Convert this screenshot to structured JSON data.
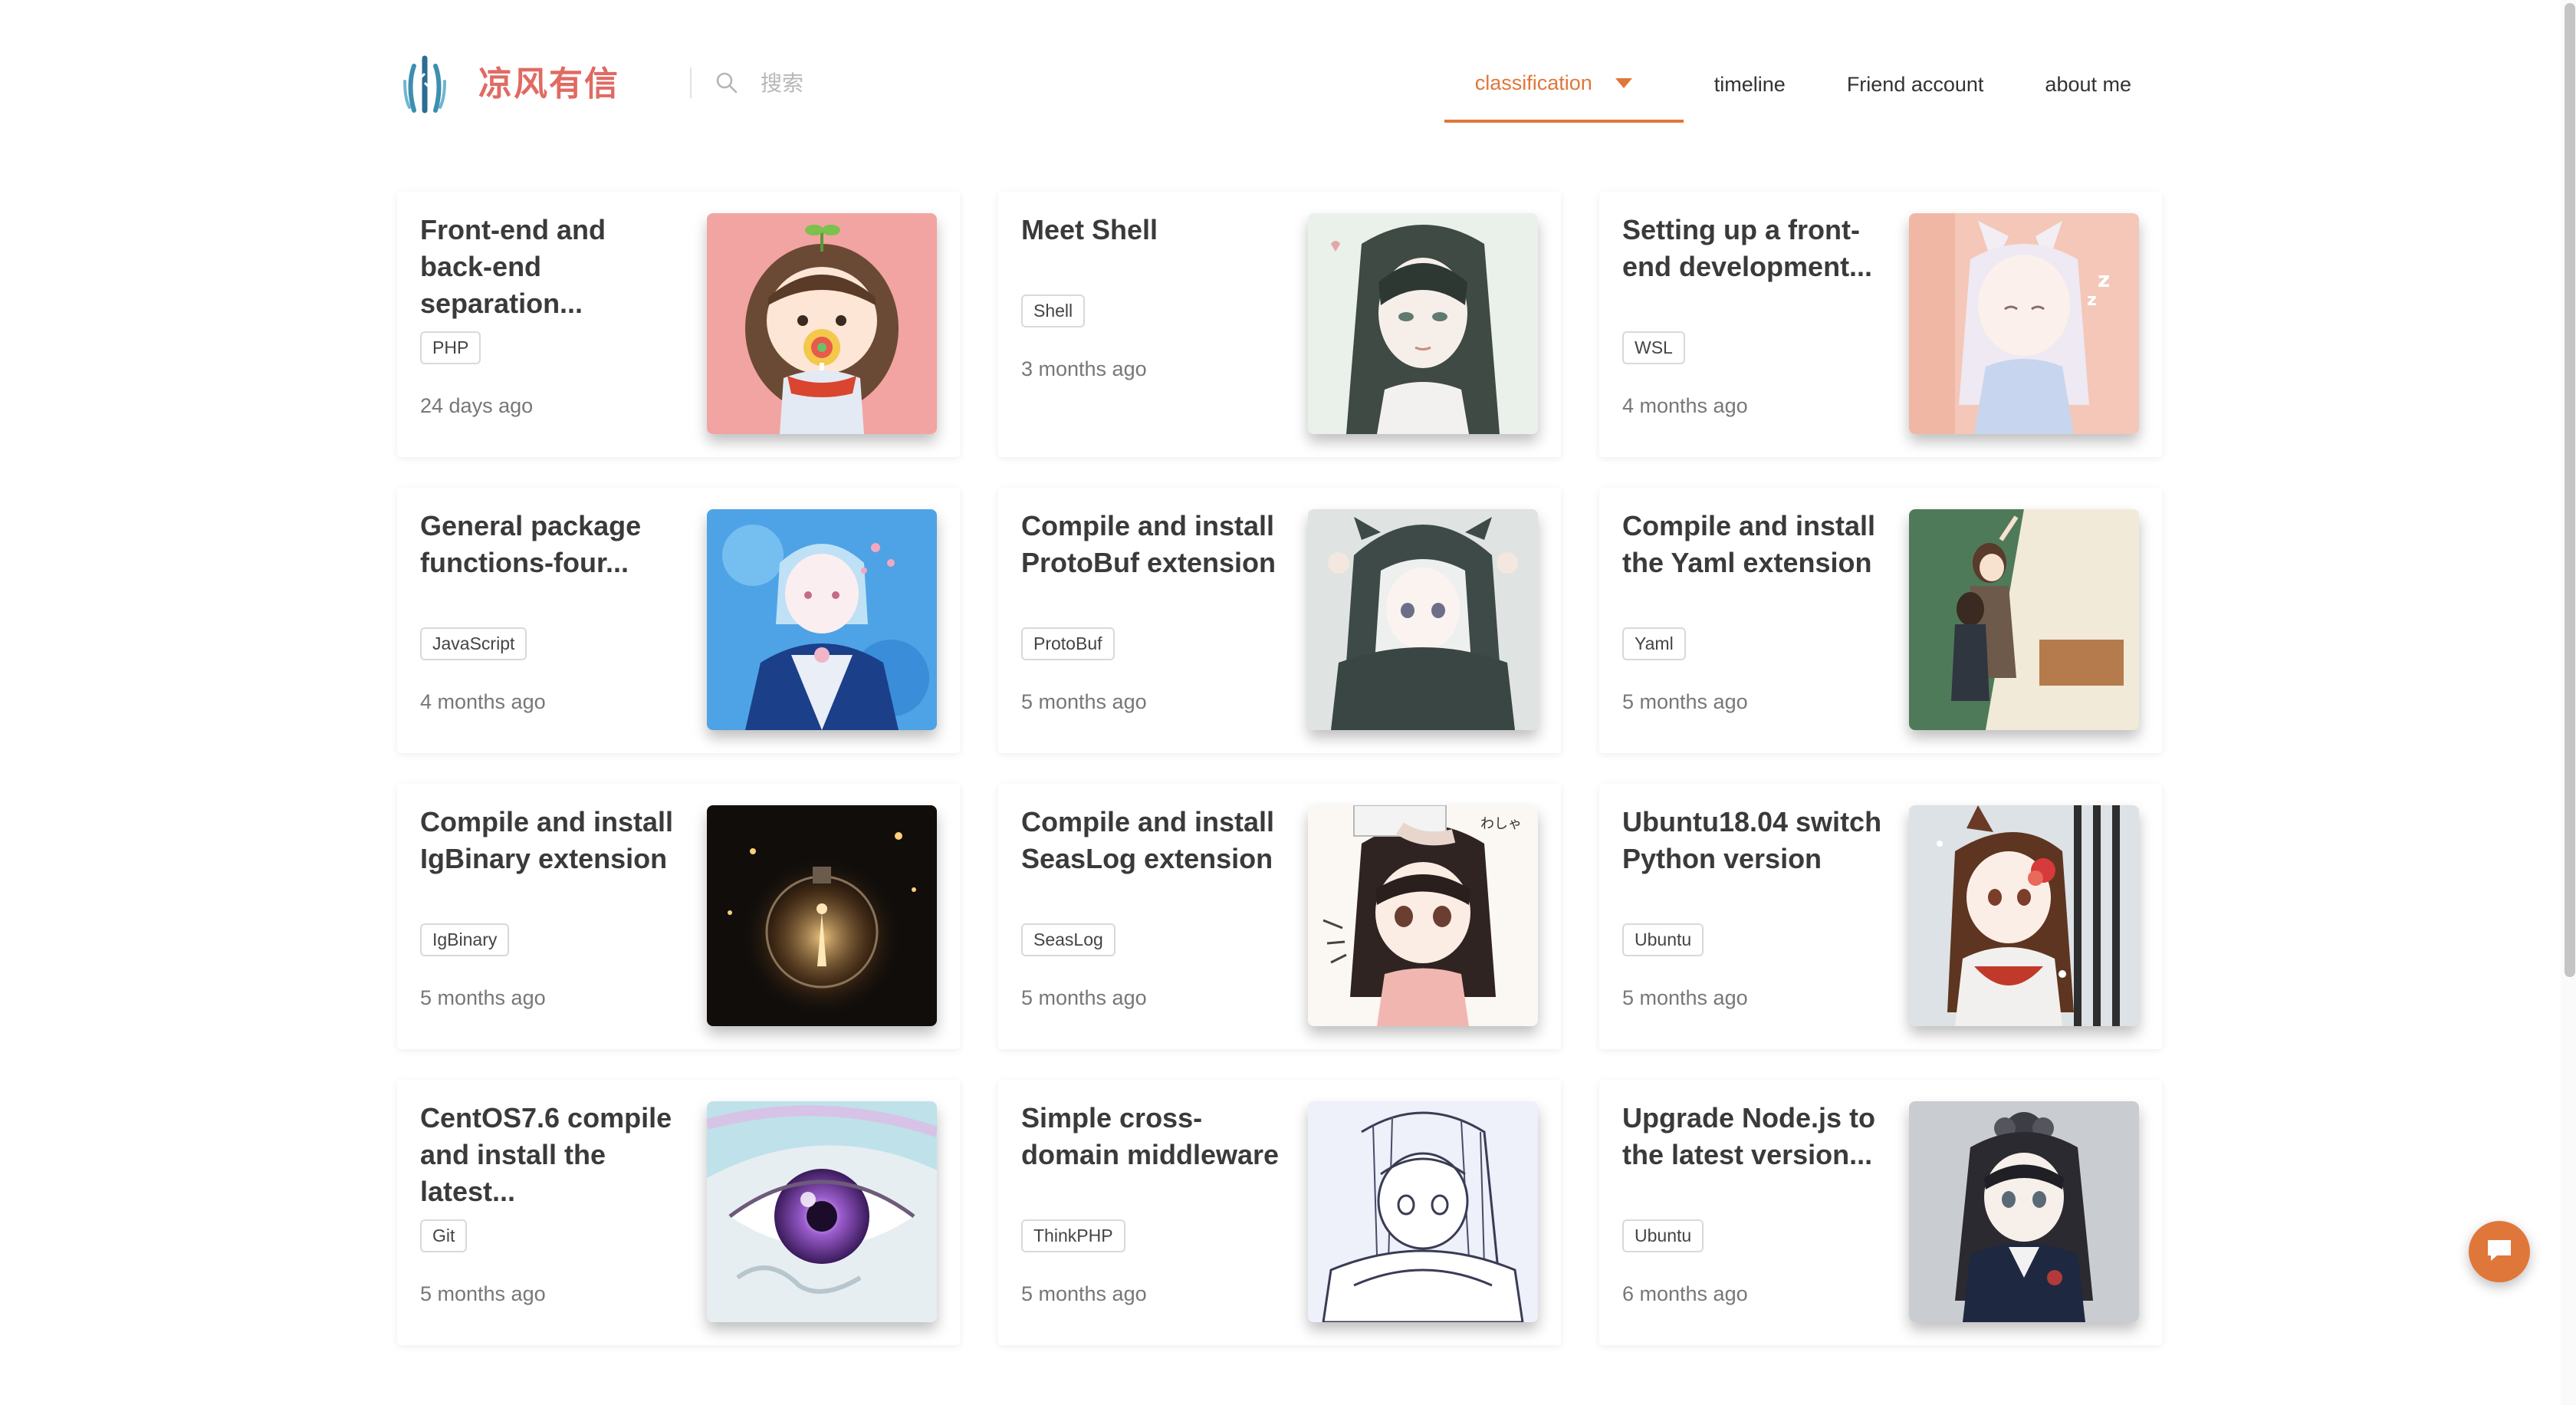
{
  "header": {
    "brand": "凉风有信",
    "search_placeholder": "搜索",
    "nav": [
      {
        "label": "classification",
        "active": true
      },
      {
        "label": "timeline"
      },
      {
        "label": "Friend account"
      },
      {
        "label": "about me"
      }
    ]
  },
  "posts": [
    {
      "title": "Front-end and back-end separation...",
      "tag": "PHP",
      "time": "24 days ago",
      "image": "girl-with-lollipop"
    },
    {
      "title": "Meet Shell",
      "tag": "Shell",
      "time": "3 months ago",
      "image": "long-haired-girl"
    },
    {
      "title": "Setting up a front-end development...",
      "tag": "WSL",
      "time": "4 months ago",
      "image": "cat-ear-girl-sleeping"
    },
    {
      "title": "General package functions-four...",
      "tag": "JavaScript",
      "time": "4 months ago",
      "image": "blue-underwater-boy"
    },
    {
      "title": "Compile and install ProtoBuf extension",
      "tag": "ProtoBuf",
      "time": "5 months ago",
      "image": "hooded-girl"
    },
    {
      "title": "Compile and install the Yaml extension",
      "tag": "Yaml",
      "time": "5 months ago",
      "image": "couple-at-blackboard"
    },
    {
      "title": "Compile and install IgBinary extension",
      "tag": "IgBinary",
      "time": "5 months ago",
      "image": "light-bulb-girl"
    },
    {
      "title": "Compile and install SeasLog extension",
      "tag": "SeasLog",
      "time": "5 months ago",
      "image": "head-pat-girl"
    },
    {
      "title": "Ubuntu18.04 switch Python version",
      "tag": "Ubuntu",
      "time": "5 months ago",
      "image": "snow-fox-girl"
    },
    {
      "title": "CentOS7.6 compile and install the latest...",
      "tag": "Git",
      "time": "5 months ago",
      "image": "purple-eye"
    },
    {
      "title": "Simple cross-domain middleware",
      "tag": "ThinkPHP",
      "time": "5 months ago",
      "image": "sketch-girl"
    },
    {
      "title": "Upgrade Node.js to the latest version...",
      "tag": "Ubuntu",
      "time": "6 months ago",
      "image": "gothic-girl"
    }
  ],
  "colors": {
    "accent": "#e0773a",
    "brand": "#e06a63"
  },
  "icons": {
    "logo": "bamboo-logo-icon",
    "search": "search-icon",
    "caret": "caret-down-icon",
    "chat": "chat-bubble-icon"
  }
}
